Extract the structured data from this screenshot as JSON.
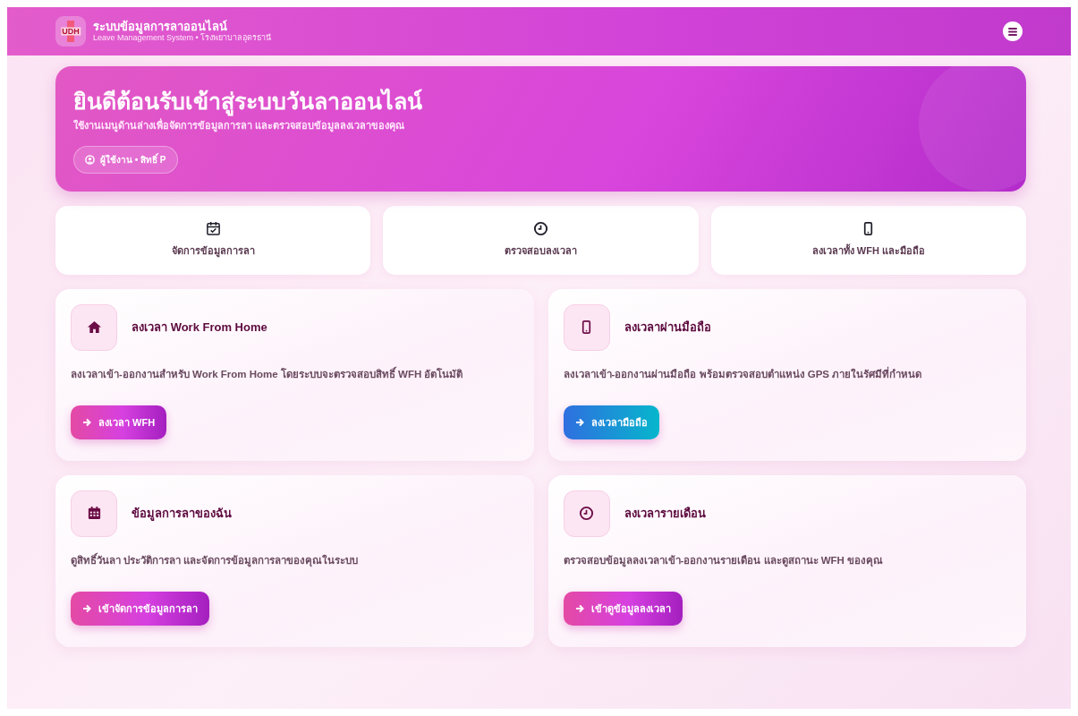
{
  "navbar": {
    "logo_text": "UDH",
    "title": "ระบบข้อมูลการลาออนไลน์",
    "subtitle": "Leave Management System • โรงพยาบาลอุดรธานี"
  },
  "hero": {
    "title": "ยินดีต้อนรับเข้าสู่ระบบวันลาออนไลน์",
    "subtitle": "ใช้งานเมนูด้านล่างเพื่อจัดการข้อมูลการลา และตรวจสอบข้อมูลลงเวลาของคุณ",
    "user_chip": "ผู้ใช้งาน • สิทธิ์ P"
  },
  "quick_links": [
    {
      "label": "จัดการข้อมูลการลา"
    },
    {
      "label": "ตรวจสอบลงเวลา"
    },
    {
      "label": "ลงเวลาทั้ง WFH และมือถือ"
    }
  ],
  "cards": [
    {
      "title": "ลงเวลา **Work From Home**",
      "description": "ลงเวลาเข้า-ออกงานสำหรับ Work From Home โดยระบบจะตรวจสอบสิทธิ์ WFH อัตโนมัติ",
      "button": "ลงเวลา WFH",
      "kind": "primary"
    },
    {
      "title": "ลงเวลาผ่านมือถือ",
      "description": "ลงเวลาเข้า-ออกงานผ่านมือถือ พร้อมตรวจสอบตำแหน่ง GPS ภายในรัศมีที่กำหนด",
      "button": "ลงเวลามือถือ",
      "kind": "info"
    },
    {
      "title": "ข้อมูลการลาของฉัน",
      "description": "ดูสิทธิ์วันลา ประวัติการลา และจัดการข้อมูลการลาของคุณในระบบ",
      "button": "เข้าจัดการข้อมูลการลา",
      "kind": "primary"
    },
    {
      "title": "ลงเวลารายเดือน",
      "description": "ตรวจสอบข้อมูลลงเวลาเข้า-ออกงานรายเดือน และดูสถานะ WFH ของคุณ",
      "button": "เข้าดูข้อมูลลงเวลา",
      "kind": "primary"
    }
  ]
}
